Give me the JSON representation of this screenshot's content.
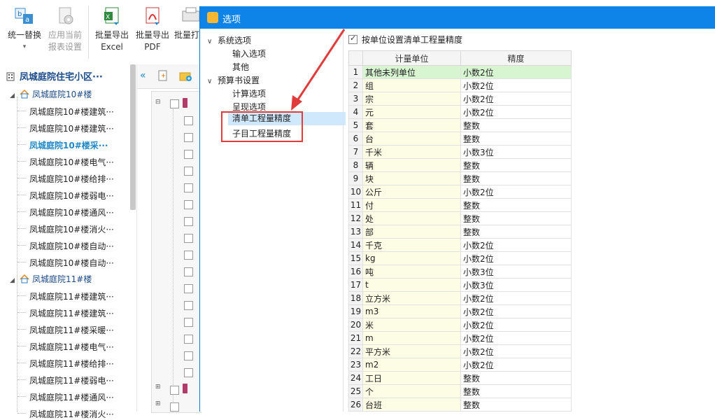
{
  "toolbar": {
    "buttons": [
      {
        "label": "统一替换",
        "sub": "▾",
        "icon": "replace-icon"
      },
      {
        "label": "应用当前",
        "sub": "报表设置",
        "icon": "gear-doc-icon",
        "disabled": true
      },
      {
        "label": "批量导出",
        "sub": "Excel",
        "icon": "excel-icon"
      },
      {
        "label": "批量导出",
        "sub": "PDF",
        "icon": "pdf-icon"
      },
      {
        "label": "批量打",
        "sub": "",
        "icon": "print-icon"
      }
    ]
  },
  "project_tree": {
    "title": "凤城庭院住宅小区···",
    "groups": [
      {
        "label": "凤城庭院10#楼",
        "items": [
          "凤城庭院10#楼建筑···",
          "凤城庭院10#楼建筑···",
          "凤城庭院10#楼采···",
          "凤城庭院10#楼电气···",
          "凤城庭院10#楼给排···",
          "凤城庭院10#楼弱电···",
          "凤城庭院10#楼通风···",
          "凤城庭院10#楼消火···",
          "凤城庭院10#楼自动···",
          "凤城庭院10#楼自动···"
        ]
      },
      {
        "label": "凤城庭院11#楼",
        "items": [
          "凤城庭院11#楼建筑···",
          "凤城庭院11#楼建筑···",
          "凤城庭院11#楼采暖···",
          "凤城庭院11#楼电气···",
          "凤城庭院11#楼给排···",
          "凤城庭院11#楼弱电···",
          "凤城庭院11#楼通风···",
          "凤城庭院11#楼消火···"
        ]
      }
    ]
  },
  "dialog": {
    "title": "选项",
    "nav": [
      {
        "group": "系统选项",
        "items": [
          "输入选项",
          "其他"
        ]
      },
      {
        "group": "预算书设置",
        "items": [
          "计算选项",
          "呈现选项",
          "清单工程量精度",
          "子目工程量精度"
        ]
      }
    ],
    "selected_item": "清单工程量精度",
    "checkbox_label": "按单位设置清单工程量精度",
    "headers": {
      "unit": "计量单位",
      "precision": "精度"
    },
    "rows": [
      {
        "n": "1",
        "unit": "其他未列单位",
        "precision": "小数2位"
      },
      {
        "n": "2",
        "unit": "组",
        "precision": "小数2位"
      },
      {
        "n": "3",
        "unit": "宗",
        "precision": "小数2位"
      },
      {
        "n": "4",
        "unit": "元",
        "precision": "小数2位"
      },
      {
        "n": "5",
        "unit": "套",
        "precision": "整数"
      },
      {
        "n": "6",
        "unit": "台",
        "precision": "整数"
      },
      {
        "n": "7",
        "unit": "千米",
        "precision": "小数3位"
      },
      {
        "n": "8",
        "unit": "辆",
        "precision": "整数"
      },
      {
        "n": "9",
        "unit": "块",
        "precision": "整数"
      },
      {
        "n": "10",
        "unit": "公斤",
        "precision": "小数2位"
      },
      {
        "n": "11",
        "unit": "付",
        "precision": "整数"
      },
      {
        "n": "12",
        "unit": "处",
        "precision": "整数"
      },
      {
        "n": "13",
        "unit": "部",
        "precision": "整数"
      },
      {
        "n": "14",
        "unit": "千克",
        "precision": "小数2位"
      },
      {
        "n": "15",
        "unit": "kg",
        "precision": "小数2位"
      },
      {
        "n": "16",
        "unit": "吨",
        "precision": "小数3位"
      },
      {
        "n": "17",
        "unit": "t",
        "precision": "小数3位"
      },
      {
        "n": "18",
        "unit": "立方米",
        "precision": "小数2位"
      },
      {
        "n": "19",
        "unit": "m3",
        "precision": "小数2位"
      },
      {
        "n": "20",
        "unit": "米",
        "precision": "小数2位"
      },
      {
        "n": "21",
        "unit": "m",
        "precision": "小数2位"
      },
      {
        "n": "22",
        "unit": "平方米",
        "precision": "小数2位"
      },
      {
        "n": "23",
        "unit": "m2",
        "precision": "小数2位"
      },
      {
        "n": "24",
        "unit": "工日",
        "precision": "整数"
      },
      {
        "n": "25",
        "unit": "个",
        "precision": "整数"
      },
      {
        "n": "26",
        "unit": "台班",
        "precision": "整数"
      }
    ]
  },
  "colors": {
    "title_bar": "#0e84e8",
    "highlight": "#e23b3b",
    "selected_nav": "#cfe8fb",
    "first_row": "#d8f5d2",
    "unit_cell": "#fdfde6"
  }
}
